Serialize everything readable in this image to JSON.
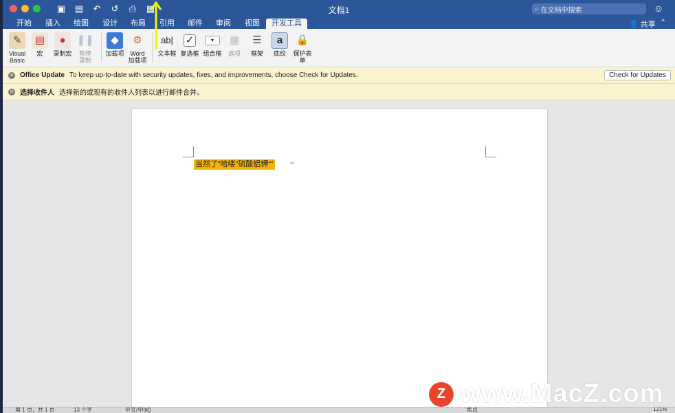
{
  "window": {
    "title": "文档1"
  },
  "quick_access": [
    {
      "name": "sidebar-toggle-icon",
      "glyph": "▣"
    },
    {
      "name": "save-icon",
      "glyph": "▤"
    },
    {
      "name": "undo-icon",
      "glyph": "↶"
    },
    {
      "name": "redo-icon",
      "glyph": "↺"
    },
    {
      "name": "print-icon",
      "glyph": "⎙"
    },
    {
      "name": "layout-icon",
      "glyph": "▦"
    }
  ],
  "search": {
    "placeholder": "在文档中搜索",
    "icon": "search-icon"
  },
  "tabs": [
    "开始",
    "插入",
    "绘图",
    "设计",
    "布局",
    "引用",
    "邮件",
    "审阅",
    "视图",
    "开发工具"
  ],
  "active_tab": "开发工具",
  "share": {
    "label": "共享"
  },
  "ribbon": {
    "visual_basic": "Visual Basic",
    "macro": "宏",
    "record_macro": "录制宏",
    "pause_recording": "暂停录制",
    "add_ins": "加载项",
    "word_add_ins": "Word 加载项",
    "text_box": "文本框",
    "checkbox": "复选框",
    "combo_box": "组合框",
    "options": "选项",
    "frame": "框架",
    "shading": "底纹",
    "protect_form": "保护表单"
  },
  "messages": {
    "update_title": "Office Update",
    "update_text": "To keep up-to-date with security updates, fixes, and improvements, choose Check for Updates.",
    "update_button": "Check for Updates",
    "recipient_title": "选择收件人",
    "recipient_text": "选择新的或现有的收件人列表以进行邮件合并。"
  },
  "document": {
    "selected_text": "当然了“哈喽”硫酸铝钾“”"
  },
  "status": {
    "page": "第 1 页，共 1 页",
    "words": "13 个字",
    "language": "中文(中国)",
    "focus": "焦点",
    "zoom": "121%"
  },
  "watermark": {
    "text": "www.MacZ.com",
    "logo": "Z"
  },
  "colors": {
    "title_bar": "#2b579a",
    "message_bar": "#fbf2cf",
    "highlight": "#f4b400",
    "annotation_arrow": "#f5f500"
  }
}
